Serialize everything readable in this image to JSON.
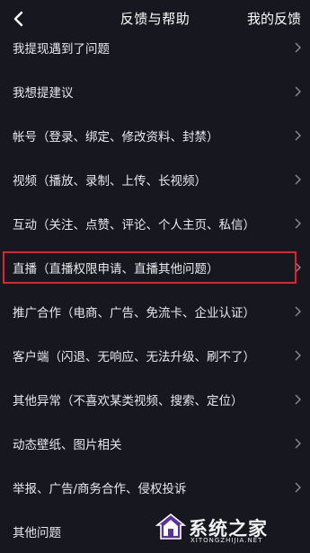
{
  "header": {
    "back_icon": "chevron-left-icon",
    "title": "反馈与帮助",
    "right_action": "我的反馈"
  },
  "items": [
    {
      "label": "我提现遇到了问题"
    },
    {
      "label": "我想提建议"
    },
    {
      "label": "帐号（登录、绑定、修改资料、封禁）"
    },
    {
      "label": "视频（播放、录制、上传、长视频）"
    },
    {
      "label": "互动（关注、点赞、评论、个人主页、私信）"
    },
    {
      "label": "直播（直播权限申请、直播其他问题）",
      "highlighted": true
    },
    {
      "label": "推广合作（电商、广告、免流卡、企业认证）"
    },
    {
      "label": "客户端（闪退、无响应、无法升级、刷不了）"
    },
    {
      "label": "其他异常（不喜欢某类视频、搜索、定位）"
    },
    {
      "label": "动态壁纸、图片相关"
    },
    {
      "label": "举报、广告/商务合作、侵权投诉"
    },
    {
      "label": "其他问题"
    }
  ],
  "item_icon": "chevron-right-icon",
  "highlight_color": "#e0242c",
  "watermark": {
    "text": "系统之家",
    "sub": "XITONGZHIJIA.NET"
  }
}
